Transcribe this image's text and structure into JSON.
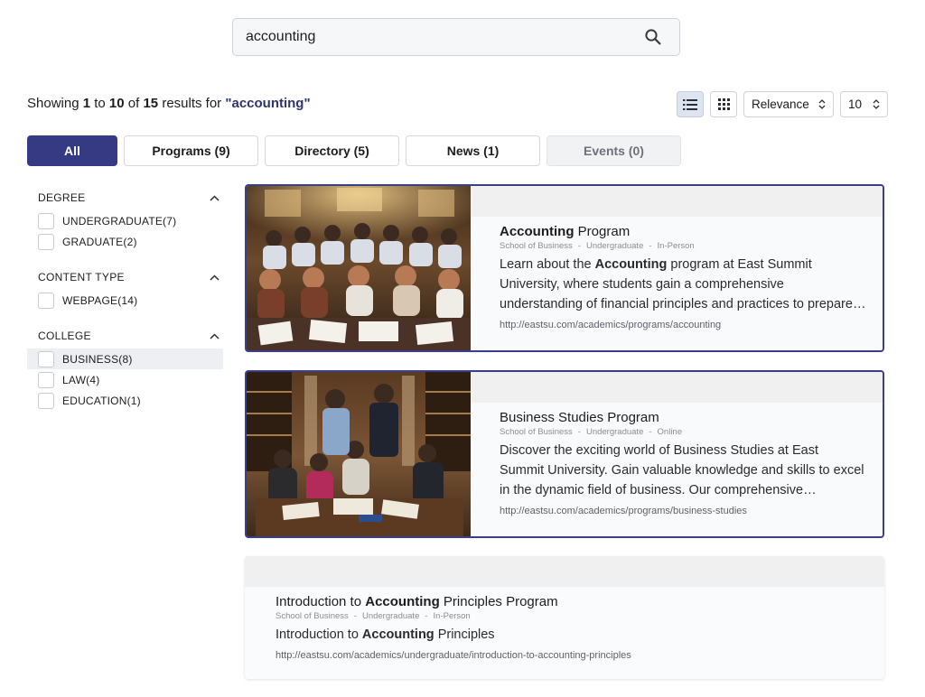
{
  "search": {
    "value": "accounting",
    "placeholder": ""
  },
  "summary": {
    "prefix": "Showing",
    "from": "1",
    "to_word": "to",
    "to": "10",
    "of_word": "of",
    "total": "15",
    "results_for": "results for",
    "query": "\"accounting\""
  },
  "controls": {
    "sort": {
      "value": "Relevance",
      "options": [
        "Relevance"
      ]
    },
    "per_page": {
      "value": "10",
      "options": [
        "10"
      ]
    },
    "view_mode": "list"
  },
  "tabs": [
    {
      "label": "All",
      "state": "active"
    },
    {
      "label": "Programs (9)",
      "state": "normal"
    },
    {
      "label": "Directory (5)",
      "state": "normal"
    },
    {
      "label": "News (1)",
      "state": "normal"
    },
    {
      "label": "Events (0)",
      "state": "disabled"
    }
  ],
  "filters": [
    {
      "title": "DEGREE",
      "items": [
        {
          "label": "UNDERGRADUATE(7)"
        },
        {
          "label": "GRADUATE(2)"
        }
      ]
    },
    {
      "title": "CONTENT TYPE",
      "items": [
        {
          "label": "WEBPAGE(14)"
        }
      ]
    },
    {
      "title": "COLLEGE",
      "items": [
        {
          "label": "BUSINESS(8)",
          "hover": true
        },
        {
          "label": "LAW(4)"
        },
        {
          "label": "EDUCATION(1)"
        }
      ]
    }
  ],
  "results": [
    {
      "title_parts": [
        {
          "text": "Accounting",
          "bold": true
        },
        {
          "text": " Program",
          "bold": false
        }
      ],
      "meta": [
        "School of Business",
        "Undergraduate",
        "In-Person"
      ],
      "desc_parts": [
        {
          "text": "Learn about the ",
          "bold": false
        },
        {
          "text": "Accounting",
          "bold": true
        },
        {
          "text": " program at East Summit University, where students gain a comprehensive understanding of financial principles and practices to prepare for successful careers in accounting.",
          "bold": false
        }
      ],
      "url": "http://eastsu.com/academics/programs/accounting",
      "image": "students-lecture-hall",
      "image_alt": "Students studying in a lecture hall"
    },
    {
      "title_parts": [
        {
          "text": "Business Studies Program",
          "bold": false
        }
      ],
      "meta": [
        "School of Business",
        "Undergraduate",
        "Online"
      ],
      "desc_parts": [
        {
          "text": "Discover the exciting world of Business Studies at East Summit University. Gain valuable knowledge and skills to excel in the dynamic field of business. Our comprehensive curriculum covers every aspect of modern business.",
          "bold": false
        }
      ],
      "url": "http://eastsu.com/academics/programs/business-studies",
      "image": "students-library-group",
      "image_alt": "Group of students studying in a library"
    },
    {
      "title_parts": [
        {
          "text": "Introduction to ",
          "bold": false
        },
        {
          "text": "Accounting",
          "bold": true
        },
        {
          "text": " Principles Program",
          "bold": false
        }
      ],
      "meta": [
        "School of Business",
        "Undergraduate",
        "In-Person"
      ],
      "desc_parts": [
        {
          "text": "Introduction to ",
          "bold": false
        },
        {
          "text": "Accounting",
          "bold": true
        },
        {
          "text": " Principles",
          "bold": false
        }
      ],
      "url": "http://eastsu.com/academics/undergraduate/introduction-to-accounting-principles",
      "image": null
    }
  ],
  "colors": {
    "accent": "#353a82",
    "query": "#2e3470",
    "card_border": "#3b3f86"
  },
  "icons": {
    "search": "search-icon",
    "list_view": "list-view-icon",
    "grid_view": "grid-view-icon",
    "select": "chevron-up-down-icon",
    "facet_toggle": "chevron-up-icon"
  }
}
